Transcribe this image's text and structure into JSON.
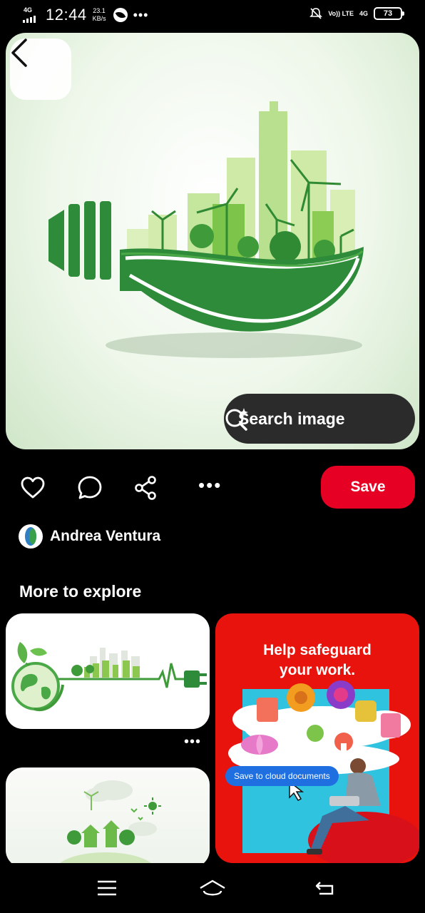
{
  "status_bar": {
    "network": "4G",
    "time": "12:44",
    "speed_value": "23.1",
    "speed_unit": "KB/s",
    "volte": "Vo)) LTE",
    "network_right": "4G",
    "battery": "73"
  },
  "hero": {
    "search_label": "Search image"
  },
  "actions": {
    "save_label": "Save"
  },
  "author": {
    "name": "Andrea Ventura"
  },
  "explore": {
    "title": "More to explore",
    "ad_headline_line1": "Help safeguard",
    "ad_headline_line2": "your work.",
    "ad_cloud_label": "Save to cloud documents"
  },
  "icons": [
    "back-icon",
    "search-lens-icon",
    "heart-icon",
    "comment-icon",
    "share-icon",
    "more-icon",
    "menu-icon",
    "home-icon",
    "nav-back-icon"
  ],
  "colors": {
    "accent": "#e60023",
    "ad_background": "#e8130c",
    "bulb_green": "#2e8b3a"
  }
}
